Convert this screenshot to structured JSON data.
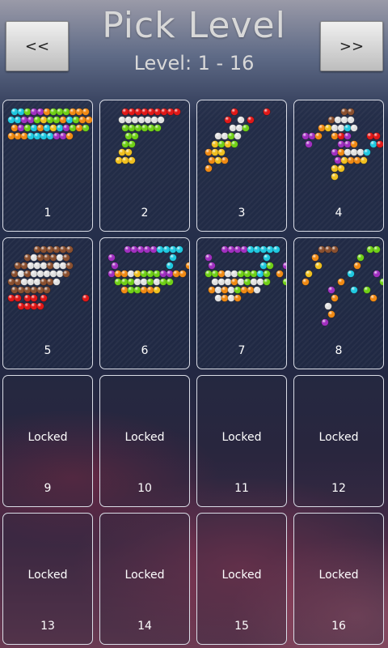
{
  "header": {
    "title": "Pick Level",
    "subtitle": "Level: 1 - 16",
    "prev_label": "<<",
    "next_label": ">>"
  },
  "colors": {
    "red": "#e01818",
    "orange": "#f08a14",
    "yellow": "#f0c020",
    "green": "#70d018",
    "cyan": "#20c8e0",
    "purple": "#a030c0",
    "white": "#e0e0e0",
    "brown": "#8a5030"
  },
  "levels": [
    {
      "number": "1",
      "locked": false
    },
    {
      "number": "2",
      "locked": false
    },
    {
      "number": "3",
      "locked": false
    },
    {
      "number": "4",
      "locked": false
    },
    {
      "number": "5",
      "locked": false
    },
    {
      "number": "6",
      "locked": false
    },
    {
      "number": "7",
      "locked": false
    },
    {
      "number": "8",
      "locked": false
    },
    {
      "number": "9",
      "locked": true,
      "status": "Locked"
    },
    {
      "number": "10",
      "locked": true,
      "status": "Locked"
    },
    {
      "number": "11",
      "locked": true,
      "status": "Locked"
    },
    {
      "number": "12",
      "locked": true,
      "status": "Locked"
    },
    {
      "number": "13",
      "locked": true,
      "status": "Locked"
    },
    {
      "number": "14",
      "locked": true,
      "status": "Locked"
    },
    {
      "number": "15",
      "locked": true,
      "status": "Locked"
    },
    {
      "number": "16",
      "locked": true,
      "status": "Locked"
    }
  ]
}
